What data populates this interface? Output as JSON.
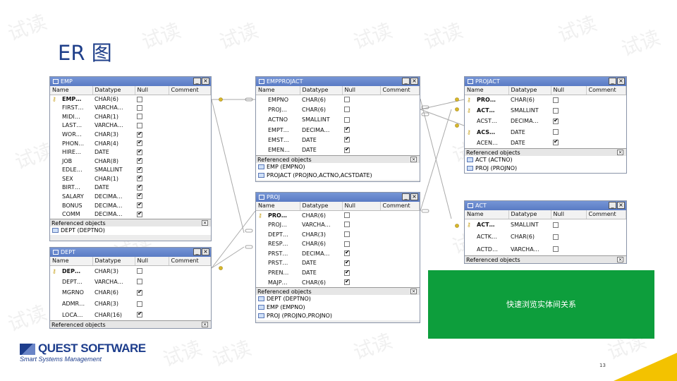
{
  "slide": {
    "title": "ER 图",
    "page_number": "13",
    "watermark": "试读"
  },
  "green_box": {
    "label": "快速浏览实体间关系"
  },
  "logo": {
    "main": "QUEST SOFTWARE",
    "sub": "Smart Systems Management"
  },
  "columns_header": {
    "name": "Name",
    "datatype": "Datatype",
    "null": "Null",
    "comment": "Comment"
  },
  "ref_header": "Referenced objects",
  "tables": {
    "emp": {
      "title": "EMP",
      "rows": [
        {
          "name": "EMP…",
          "type": "CHAR(6)",
          "null": false,
          "pk": true
        },
        {
          "name": "FIRST…",
          "type": "VARCHA…",
          "null": false
        },
        {
          "name": "MIDI…",
          "type": "CHAR(1)",
          "null": false
        },
        {
          "name": "LAST…",
          "type": "VARCHA…",
          "null": false
        },
        {
          "name": "WOR…",
          "type": "CHAR(3)",
          "null": true
        },
        {
          "name": "PHON…",
          "type": "CHAR(4)",
          "null": true
        },
        {
          "name": "HIRE…",
          "type": "DATE",
          "null": true
        },
        {
          "name": "JOB",
          "type": "CHAR(8)",
          "null": true
        },
        {
          "name": "EDLE…",
          "type": "SMALLINT",
          "null": true
        },
        {
          "name": "SEX",
          "type": "CHAR(1)",
          "null": true
        },
        {
          "name": "BIRT…",
          "type": "DATE",
          "null": true
        },
        {
          "name": "SALARY",
          "type": "DECIMA…",
          "null": true
        },
        {
          "name": "BONUS",
          "type": "DECIMA…",
          "null": true
        },
        {
          "name": "COMM",
          "type": "DECIMA…",
          "null": true
        }
      ],
      "refs": [
        "DEPT (DEPTNO)"
      ]
    },
    "dept": {
      "title": "DEPT",
      "rows": [
        {
          "name": "DEP…",
          "type": "CHAR(3)",
          "null": false,
          "pk": true
        },
        {
          "name": "DEPT…",
          "type": "VARCHA…",
          "null": false
        },
        {
          "name": "MGRNO",
          "type": "CHAR(6)",
          "null": true
        },
        {
          "name": "ADMR…",
          "type": "CHAR(3)",
          "null": false
        },
        {
          "name": "LOCA…",
          "type": "CHAR(16)",
          "null": true
        }
      ],
      "refs": []
    },
    "empprojact": {
      "title": "EMPPROJACT",
      "rows": [
        {
          "name": "EMPNO",
          "type": "CHAR(6)",
          "null": false
        },
        {
          "name": "PROJ…",
          "type": "CHAR(6)",
          "null": false
        },
        {
          "name": "ACTNO",
          "type": "SMALLINT",
          "null": false
        },
        {
          "name": "EMPT…",
          "type": "DECIMA…",
          "null": true
        },
        {
          "name": "EMST…",
          "type": "DATE",
          "null": true
        },
        {
          "name": "EMEN…",
          "type": "DATE",
          "null": true
        }
      ],
      "refs": [
        "EMP (EMPNO)",
        "PROJACT (PROJNO,ACTNO,ACSTDATE)"
      ]
    },
    "proj": {
      "title": "PROJ",
      "rows": [
        {
          "name": "PRO…",
          "type": "CHAR(6)",
          "null": false,
          "pk": true
        },
        {
          "name": "PROJ…",
          "type": "VARCHA…",
          "null": false
        },
        {
          "name": "DEPT…",
          "type": "CHAR(3)",
          "null": false
        },
        {
          "name": "RESP…",
          "type": "CHAR(6)",
          "null": false
        },
        {
          "name": "PRST…",
          "type": "DECIMA…",
          "null": true
        },
        {
          "name": "PRST…",
          "type": "DATE",
          "null": true
        },
        {
          "name": "PREN…",
          "type": "DATE",
          "null": true
        },
        {
          "name": "MAJP…",
          "type": "CHAR(6)",
          "null": true
        }
      ],
      "refs": [
        "DEPT (DEPTNO)",
        "EMP (EMPNO)",
        "PROJ (PROJNO,PROJNO)"
      ]
    },
    "projact": {
      "title": "PROJACT",
      "rows": [
        {
          "name": "PRO…",
          "type": "CHAR(6)",
          "null": false,
          "pk": true
        },
        {
          "name": "ACT…",
          "type": "SMALLINT",
          "null": false,
          "pk": true
        },
        {
          "name": "ACST…",
          "type": "DECIMA…",
          "null": true
        },
        {
          "name": "ACS…",
          "type": "DATE",
          "null": false,
          "pk": true
        },
        {
          "name": "ACEN…",
          "type": "DATE",
          "null": true
        }
      ],
      "refs": [
        "ACT (ACTNO)",
        "PROJ (PROJNO)"
      ]
    },
    "act": {
      "title": "ACT",
      "rows": [
        {
          "name": "ACT…",
          "type": "SMALLINT",
          "null": false,
          "pk": true
        },
        {
          "name": "ACTK…",
          "type": "CHAR(6)",
          "null": false
        },
        {
          "name": "ACTD…",
          "type": "VARCHA…",
          "null": false
        }
      ],
      "refs": []
    }
  }
}
